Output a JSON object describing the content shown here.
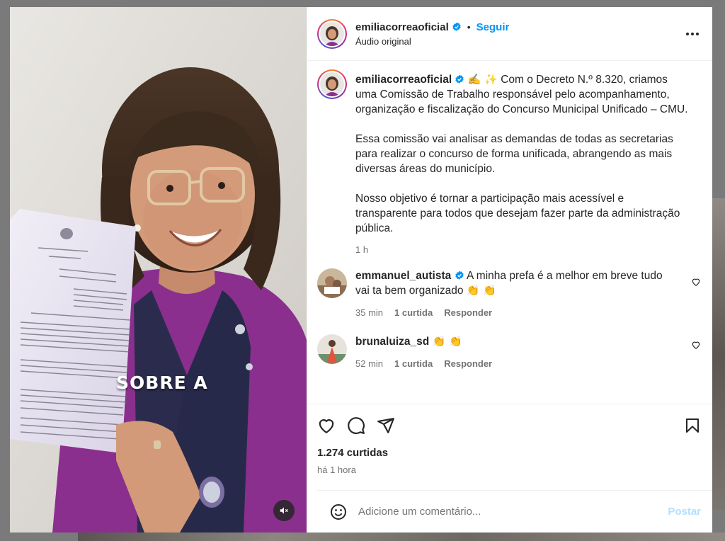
{
  "colors": {
    "accent": "#0095f6",
    "verified": "#0095f6",
    "muted": "#737373",
    "post_disabled": "#b2dffc"
  },
  "media": {
    "overlay_text": "SOBRE A",
    "mute_icon": "speaker-muted-icon"
  },
  "header": {
    "username": "emiliacorreaoficial",
    "separator": "•",
    "follow_label": "Seguir",
    "audio_label": "Áudio original",
    "more_icon": "more-options-icon"
  },
  "caption": {
    "username": "emiliacorreaoficial",
    "emojis": "✍️ ✨",
    "paragraph1": "Com o Decreto N.º 8.320, criamos uma Comissão de Trabalho responsável pelo acompanhamento, organização e fiscalização do Concurso Municipal Unificado – CMU.",
    "paragraph2": "Essa comissão vai analisar as demandas de todas as secretarias para realizar o concurso de forma unificada, abrangendo as mais diversas áreas do município.",
    "paragraph3": "Nosso objetivo é tornar a participação mais acessível e transparente para todos que desejam fazer parte da administração pública.",
    "time": "1 h"
  },
  "comments": [
    {
      "username": "emmanuel_autista",
      "verified": true,
      "text": "A minha prefa é a melhor em breve tudo vai ta bem organizado",
      "emojis": "👏 👏",
      "time": "35 min",
      "likes": "1 curtida",
      "reply": "Responder"
    },
    {
      "username": "brunaluiza_sd",
      "verified": false,
      "text": "",
      "emojis": "👏 👏",
      "time": "52 min",
      "likes": "1 curtida",
      "reply": "Responder"
    }
  ],
  "actions": {
    "likes": "1.274 curtidas",
    "time_ago": "há 1 hora"
  },
  "add_comment": {
    "placeholder": "Adicione um comentário...",
    "post_label": "Postar"
  }
}
